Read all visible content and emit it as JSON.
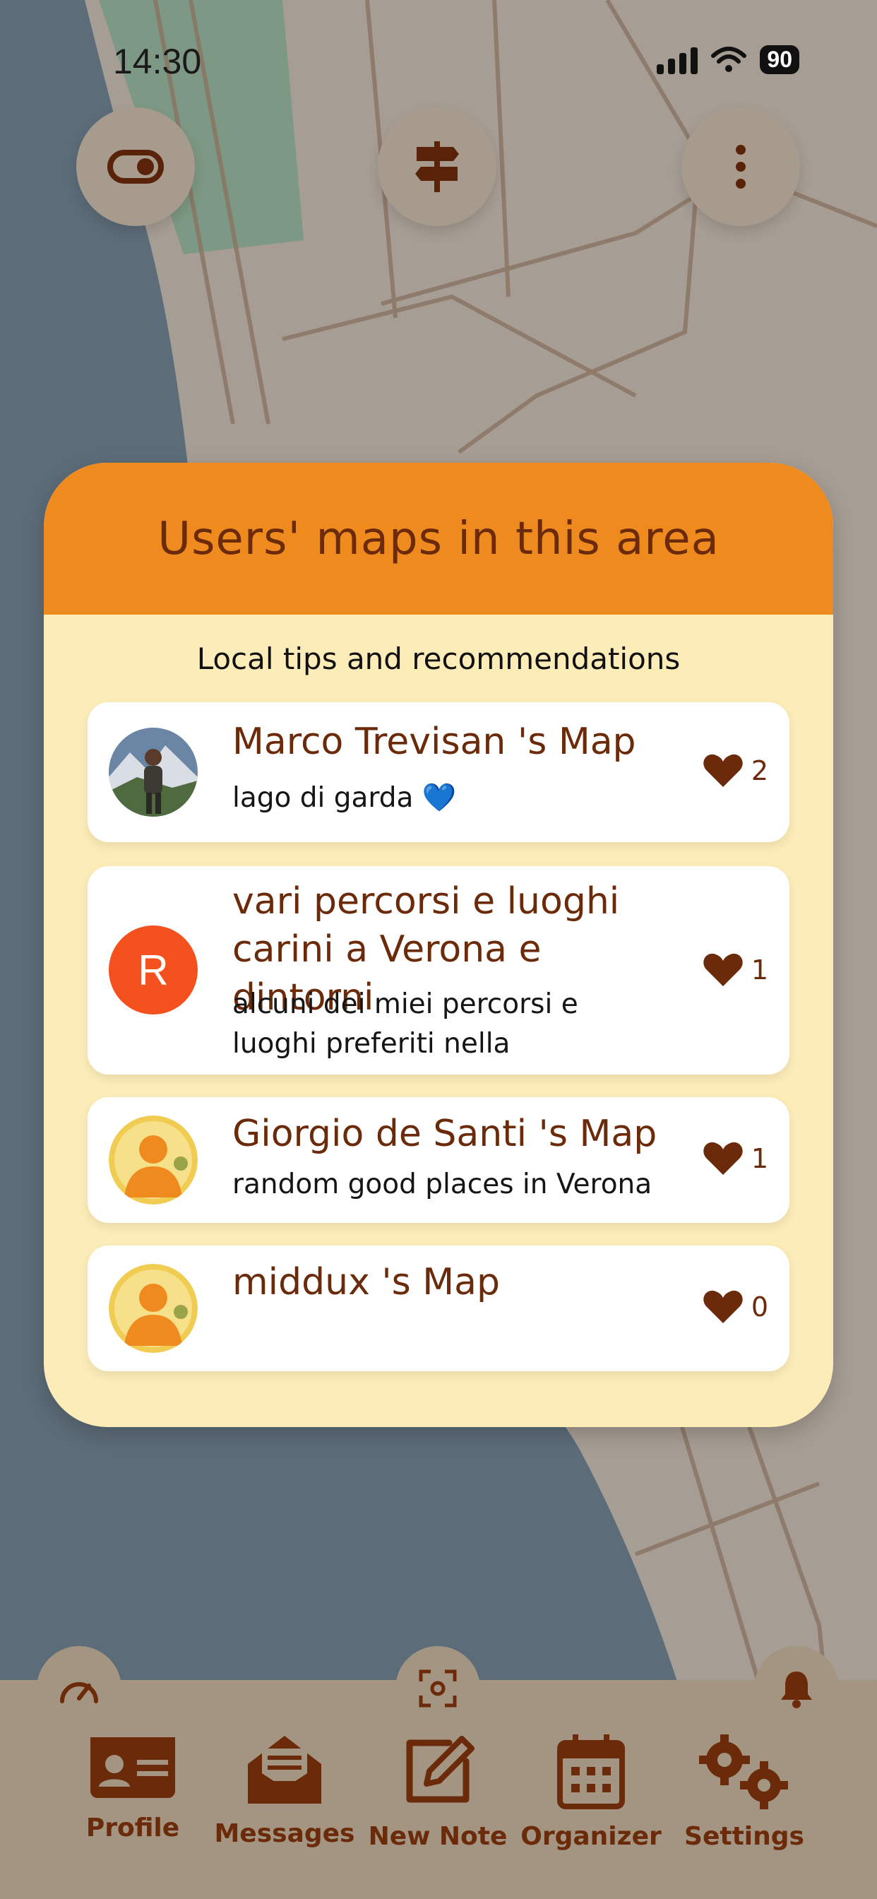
{
  "status_bar": {
    "time": "14:30",
    "battery": "90"
  },
  "top_buttons": [
    {
      "name": "toggle-icon"
    },
    {
      "name": "signpost-icon"
    },
    {
      "name": "more-vertical-icon"
    }
  ],
  "panel": {
    "title": "Users' maps in this area",
    "subtitle": "Local tips and recommendations",
    "cards": [
      {
        "title": "Marco Trevisan 's Map",
        "description": "lago di garda 💙",
        "likes": "2",
        "avatar": "photo"
      },
      {
        "title": "vari percorsi e luoghi carini a Verona e dintorni",
        "description": "alcuni dei miei percorsi e luoghi preferiti nella",
        "likes": "1",
        "avatar_letter": "R"
      },
      {
        "title": "Giorgio de Santi 's Map",
        "description": "random good places in Verona",
        "likes": "1",
        "avatar": "placeholder"
      },
      {
        "title": "middux 's Map",
        "description": "",
        "likes": "0",
        "avatar": "placeholder"
      }
    ]
  },
  "bottom_nav": {
    "tabs": [
      {
        "label": "Profile",
        "icon": "id-card-icon"
      },
      {
        "label": "Messages",
        "icon": "envelope-icon"
      },
      {
        "label": "New Note",
        "icon": "edit-icon"
      },
      {
        "label": "Organizer",
        "icon": "calendar-icon"
      },
      {
        "label": "Settings",
        "icon": "gears-icon"
      }
    ],
    "top_icons": [
      "speedometer-icon",
      "focus-scan-icon",
      "bell-icon"
    ]
  },
  "colors": {
    "accent": "#ef8b1e",
    "brown": "#6b2a09",
    "panel_bg": "#fcecb8",
    "nav_bg": "#a39581"
  }
}
